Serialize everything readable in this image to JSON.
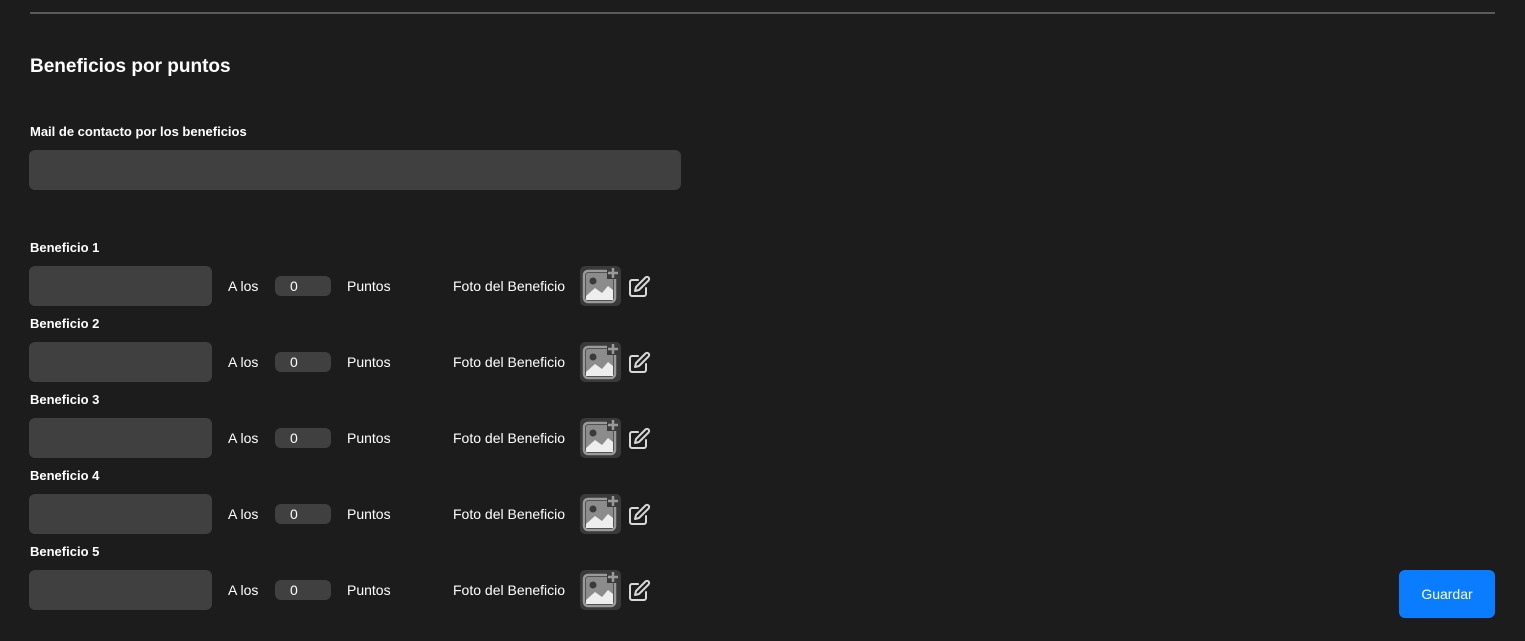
{
  "section": {
    "title": "Beneficios por puntos"
  },
  "mail": {
    "label": "Mail de contacto por los beneficios",
    "value": "",
    "placeholder": ""
  },
  "benefits": [
    {
      "label": "Beneficio 1",
      "name_value": "",
      "a_los": "A los",
      "points": "0",
      "puntos": "Puntos",
      "foto_label": "Foto del Beneficio"
    },
    {
      "label": "Beneficio 2",
      "name_value": "",
      "a_los": "A los",
      "points": "0",
      "puntos": "Puntos",
      "foto_label": "Foto del Beneficio"
    },
    {
      "label": "Beneficio 3",
      "name_value": "",
      "a_los": "A los",
      "points": "0",
      "puntos": "Puntos",
      "foto_label": "Foto del Beneficio"
    },
    {
      "label": "Beneficio 4",
      "name_value": "",
      "a_los": "A los",
      "points": "0",
      "puntos": "Puntos",
      "foto_label": "Foto del Beneficio"
    },
    {
      "label": "Beneficio 5",
      "name_value": "",
      "a_los": "A los",
      "points": "0",
      "puntos": "Puntos",
      "foto_label": "Foto del Beneficio"
    }
  ],
  "icons": {
    "photo": "add-photo-icon",
    "edit": "edit-icon"
  },
  "colors": {
    "background": "#1c1c1c",
    "input": "#404040",
    "accent": "#0a7cff",
    "icon": "#9a9a9a"
  },
  "actions": {
    "save_label": "Guardar"
  }
}
